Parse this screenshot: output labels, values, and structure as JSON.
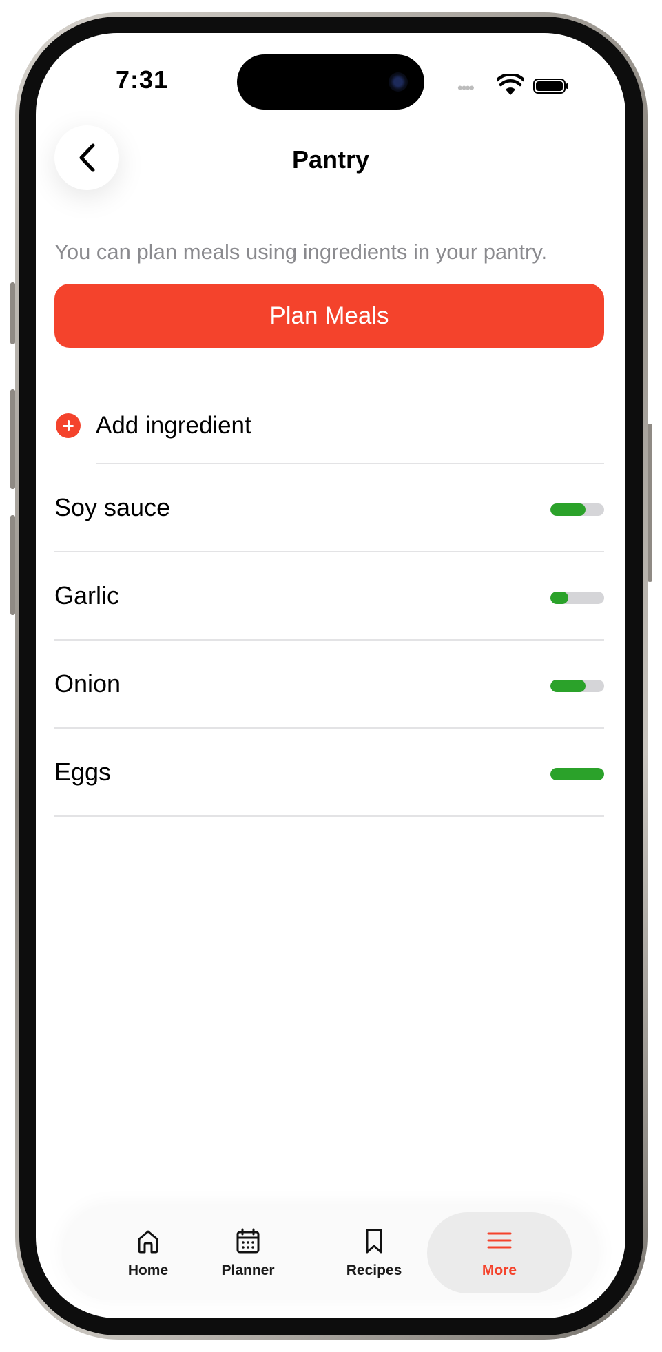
{
  "status_bar": {
    "time": "7:31"
  },
  "header": {
    "title": "Pantry",
    "back_icon": "chevron-left-icon"
  },
  "description": "You can plan meals using ingredients in your pantry.",
  "plan_button": {
    "label": "Plan Meals",
    "color": "#f4432c"
  },
  "add_ingredient": {
    "label": "Add ingredient",
    "icon": "plus-circle-icon"
  },
  "ingredients": [
    {
      "name": "Soy sauce",
      "level": 0.66
    },
    {
      "name": "Garlic",
      "level": 0.33
    },
    {
      "name": "Onion",
      "level": 0.66
    },
    {
      "name": "Eggs",
      "level": 1.0
    }
  ],
  "level_colors": {
    "fill": "#2ba22a",
    "track": "#d5d5d8"
  },
  "tabbar": {
    "tabs": [
      {
        "label": "Home",
        "icon": "home-icon",
        "active": false
      },
      {
        "label": "Planner",
        "icon": "calendar-icon",
        "active": false
      },
      {
        "label": "Recipes",
        "icon": "bookmark-icon",
        "active": false
      },
      {
        "label": "More",
        "icon": "menu-icon",
        "active": true
      }
    ],
    "active_color": "#f4432c"
  }
}
